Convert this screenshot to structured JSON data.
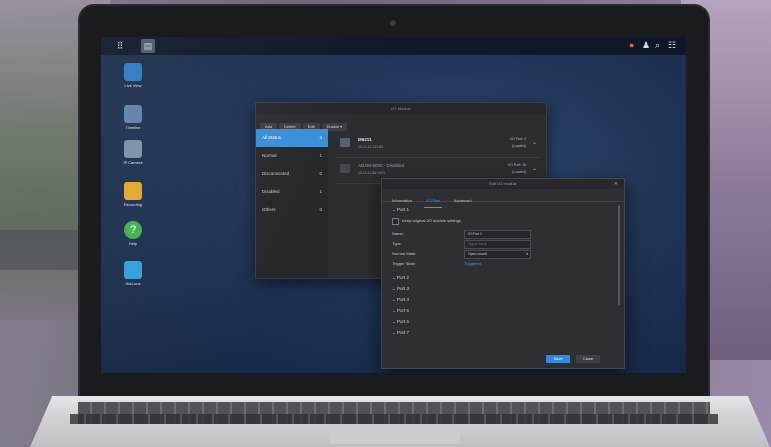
{
  "taskbar": {
    "right_icons": [
      "notification-icon",
      "user-icon",
      "search-icon",
      "widgets-icon"
    ]
  },
  "desktop_icons": [
    {
      "label": "Live View",
      "icon": "live-view-icon",
      "color": "#2a78c4"
    },
    {
      "label": "Timeline",
      "icon": "timeline-icon",
      "color": "#5c7fa8"
    },
    {
      "label": "IP Camera",
      "icon": "ip-camera-icon",
      "color": "#7a8fa6"
    },
    {
      "label": "Recording",
      "icon": "recording-icon",
      "color": "#e0a72a"
    },
    {
      "label": "Help",
      "icon": "help-icon",
      "color": "#3fb04a"
    },
    {
      "label": "Add-ons",
      "icon": "add-ons-icon",
      "color": "#2f9fd8"
    }
  ],
  "io_window": {
    "title": "I/O Module",
    "toolbar": {
      "add": "Add",
      "delete": "Delete",
      "edit": "Edit",
      "enable": "Enable ▾"
    },
    "sidebar": [
      {
        "label": "All Status",
        "count": "4"
      },
      {
        "label": "Normal",
        "count": "1"
      },
      {
        "label": "Disconnected",
        "count": "0"
      },
      {
        "label": "Disabled",
        "count": "1"
      },
      {
        "label": "Others",
        "count": "0"
      }
    ],
    "devices": [
      {
        "name": "M6211",
        "sub": "10.13.12.212:80",
        "r1": "I/O Port: 4",
        "r2": "(Loaded)"
      },
      {
        "name": "ADAM-6050 - Disabled",
        "sub": "10.13.11.66:1903",
        "r1": "I/O Port: 18",
        "r2": "(Loaded)"
      }
    ]
  },
  "dialog": {
    "title": "Edit I/O module",
    "tabs": [
      "Information",
      "I/O Port",
      "Advanced"
    ],
    "active_tab": "I/O Port",
    "port_open": "Port 1",
    "keep_settings": "Keep original I/O module settings",
    "fields": {
      "name_label": "Name:",
      "name_value": "IO Port 1",
      "type_label": "Type:",
      "type_value": "Digital Input",
      "normal_label": "Normal State:",
      "normal_value": "Open circuit",
      "trigger_label": "Trigger State:",
      "trigger_value": "Triggered"
    },
    "ports_collapsed": [
      "Port 2",
      "Port 3",
      "Port 4",
      "Port 5",
      "Port 6",
      "Port 7"
    ],
    "apply": "Save",
    "close": "Close"
  },
  "colors": {
    "accent": "#3a8fd8",
    "desktop": "#1f3356"
  }
}
